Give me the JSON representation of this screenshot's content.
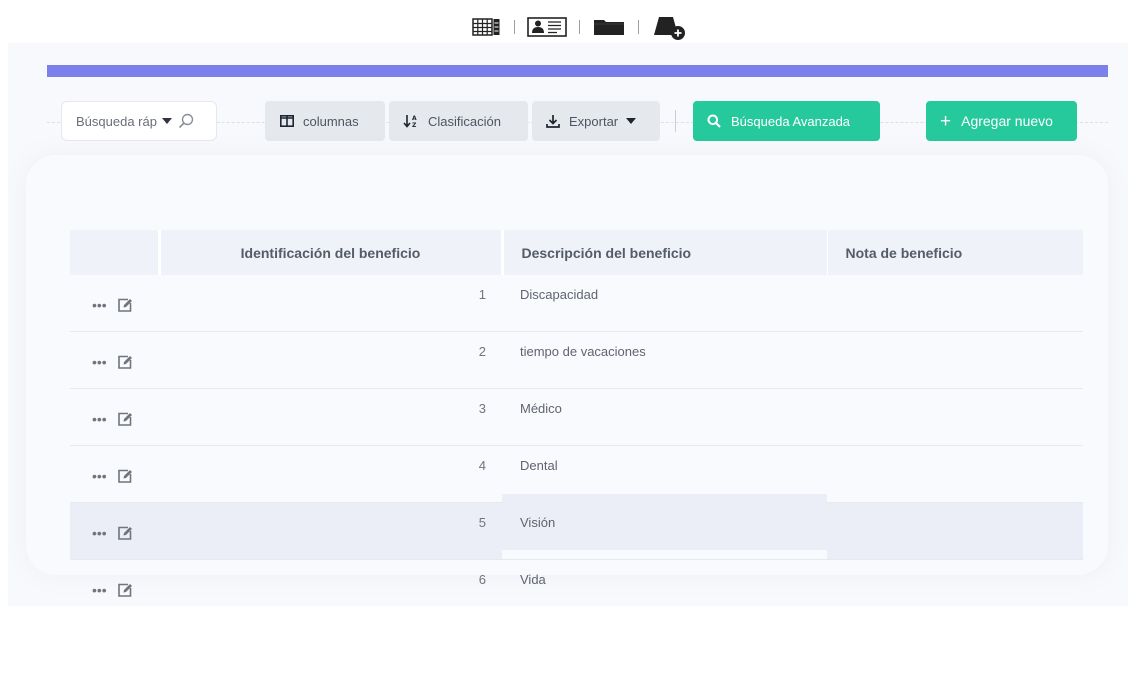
{
  "toolbar": {
    "search_placeholder": "Búsqueda ráp",
    "columns_label": "columnas",
    "sort_label": "Clasificación",
    "export_label": "Exportar",
    "advanced_search_label": "Búsqueda Avanzada",
    "add_new_label": "Agregar nuevo"
  },
  "table": {
    "headers": [
      "",
      "Identificación del beneficio",
      "Descripción del beneficio",
      "Nota de beneficio"
    ],
    "rows": [
      {
        "id": "1",
        "description": "Discapacidad",
        "note": ""
      },
      {
        "id": "2",
        "description": "tiempo de vacaciones",
        "note": ""
      },
      {
        "id": "3",
        "description": "Médico",
        "note": ""
      },
      {
        "id": "4",
        "description": "Dental",
        "note": ""
      },
      {
        "id": "5",
        "description": "Visión",
        "note": ""
      },
      {
        "id": "6",
        "description": "Vida",
        "note": ""
      }
    ]
  },
  "icons": {
    "views": [
      "grid-view-icon",
      "card-view-icon",
      "folder-view-icon",
      "add-user-view-icon"
    ],
    "row_actions": [
      "more-dots-icon",
      "edit-icon"
    ]
  },
  "colors": {
    "accent_bar": "#7b80ea",
    "primary_green": "#26c99c",
    "toolbar_button_bg": "#e5e9ee",
    "header_bg": "#eff2f8",
    "highlight_row_bg": "#ebeef6"
  }
}
